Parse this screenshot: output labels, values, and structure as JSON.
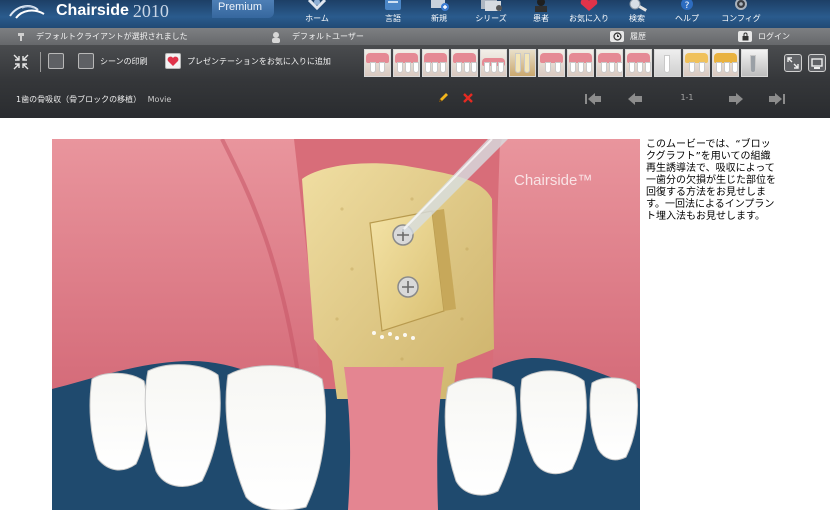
{
  "app": {
    "name": "Chairside",
    "year": "2010",
    "edition": "Premium"
  },
  "nav": [
    {
      "label": "ホーム",
      "icon": "home-icon"
    },
    {
      "label": "言語",
      "icon": "language-icon"
    },
    {
      "label": "新規",
      "icon": "new-icon"
    },
    {
      "label": "シリーズ",
      "icon": "series-icon"
    },
    {
      "label": "患者",
      "icon": "patient-icon"
    },
    {
      "label": "お気に入り",
      "icon": "favorites-icon"
    },
    {
      "label": "検索",
      "icon": "search-icon"
    },
    {
      "label": "ヘルプ",
      "icon": "help-icon"
    },
    {
      "label": "コンフィグ",
      "icon": "config-icon"
    }
  ],
  "status": {
    "client": "デフォルトクライアントが選択されました",
    "user": "デフォルトユーザー",
    "history": "履歴",
    "login": "ログイン"
  },
  "toolbar": {
    "print_scene": "シーンの印刷",
    "add_favorite": "プレゼンテーションをお気に入りに追加"
  },
  "scene": {
    "title": "1歯の骨吸収（骨ブロックの移植）",
    "type": "Movie",
    "counter": "1-1"
  },
  "illustration": {
    "watermark": "Chairside™"
  },
  "description": "このムービーでは、“ブロックグラフト”を用いての組織再生誘導法で、吸収によって一歯分の欠損が生じた部位を回復する方法をお見せします。一回法によるインプラント埋入法もお見せします。",
  "colors": {
    "accent": "#2a5b8d",
    "gum": "#e4838e",
    "bone": "#e2cf8e",
    "background_blue": "#1f4a6e",
    "edit_pencil": "#f2b51b",
    "delete_red": "#e52a22"
  }
}
